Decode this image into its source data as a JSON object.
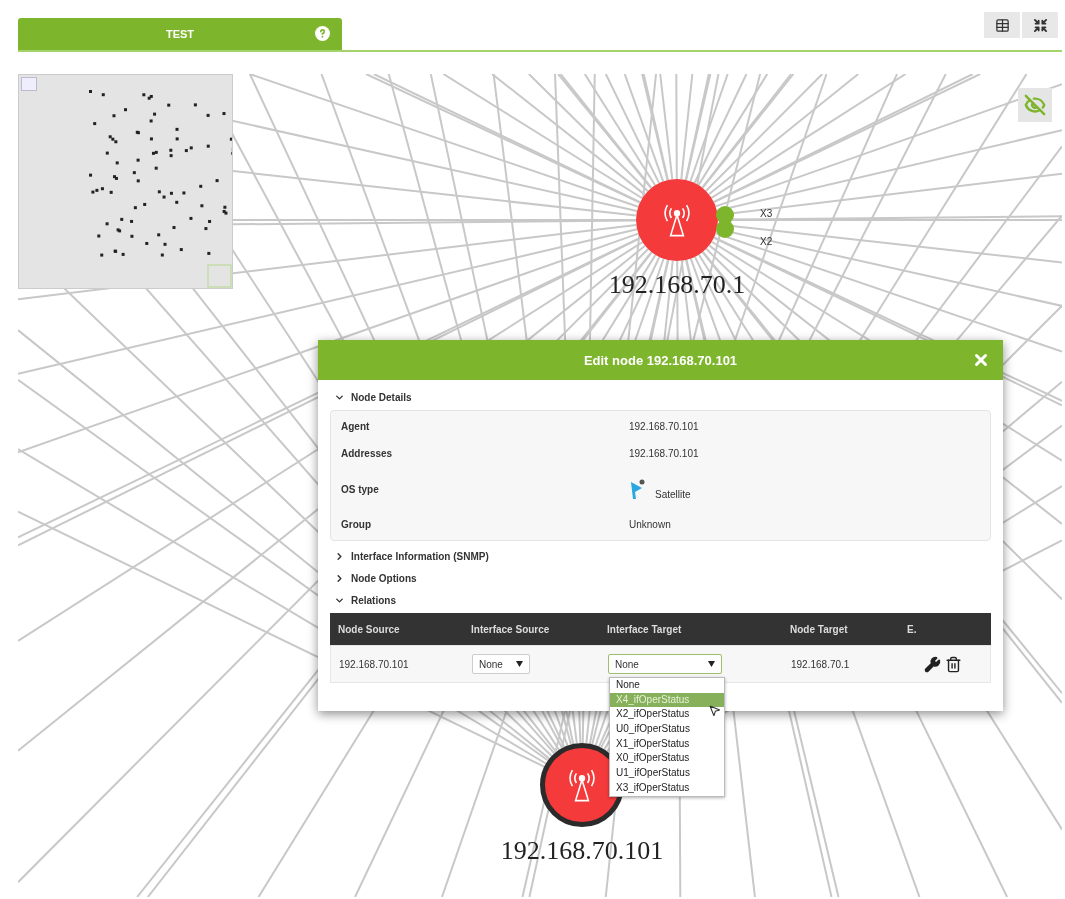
{
  "tab": {
    "label": "TEST",
    "selected": true
  },
  "nodes": [
    {
      "label": "192.168.70.1",
      "bordered": false,
      "ports": [
        {
          "label": "X3"
        },
        {
          "label": "X2"
        }
      ]
    },
    {
      "label": "192.168.70.101",
      "bordered": true
    }
  ],
  "dialog": {
    "title": "Edit node 192.168.70.101",
    "details": {
      "title": "Node Details",
      "expanded": true,
      "rows": [
        {
          "label": "Agent",
          "value": "192.168.70.101"
        },
        {
          "label": "Addresses",
          "value": "192.168.70.101"
        },
        {
          "label": "OS type",
          "value": "Satellite",
          "kind": "os"
        },
        {
          "label": "Group",
          "value": "Unknown"
        }
      ]
    },
    "collapsed": [
      {
        "title": "Interface Information (SNMP)",
        "expanded": false
      },
      {
        "title": "Node Options",
        "expanded": false
      }
    ],
    "relations": {
      "title": "Relations",
      "expanded": true,
      "columns": [
        "Node Source",
        "Interface Source",
        "Interface Target",
        "Node Target",
        "E."
      ],
      "row": {
        "node_source": "192.168.70.101",
        "interface_source": "None",
        "interface_target": "None",
        "node_target": "192.168.70.1"
      },
      "options": [
        {
          "label": "None",
          "selected": false
        },
        {
          "label": "X4_ifOperStatus",
          "selected": true
        },
        {
          "label": "X2_ifOperStatus",
          "selected": false
        },
        {
          "label": "U0_ifOperStatus",
          "selected": false
        },
        {
          "label": "X1_ifOperStatus",
          "selected": false
        },
        {
          "label": "X0_ifOperStatus",
          "selected": false
        },
        {
          "label": "U1_ifOperStatus",
          "selected": false
        },
        {
          "label": "X3_ifOperStatus",
          "selected": false
        }
      ]
    }
  }
}
